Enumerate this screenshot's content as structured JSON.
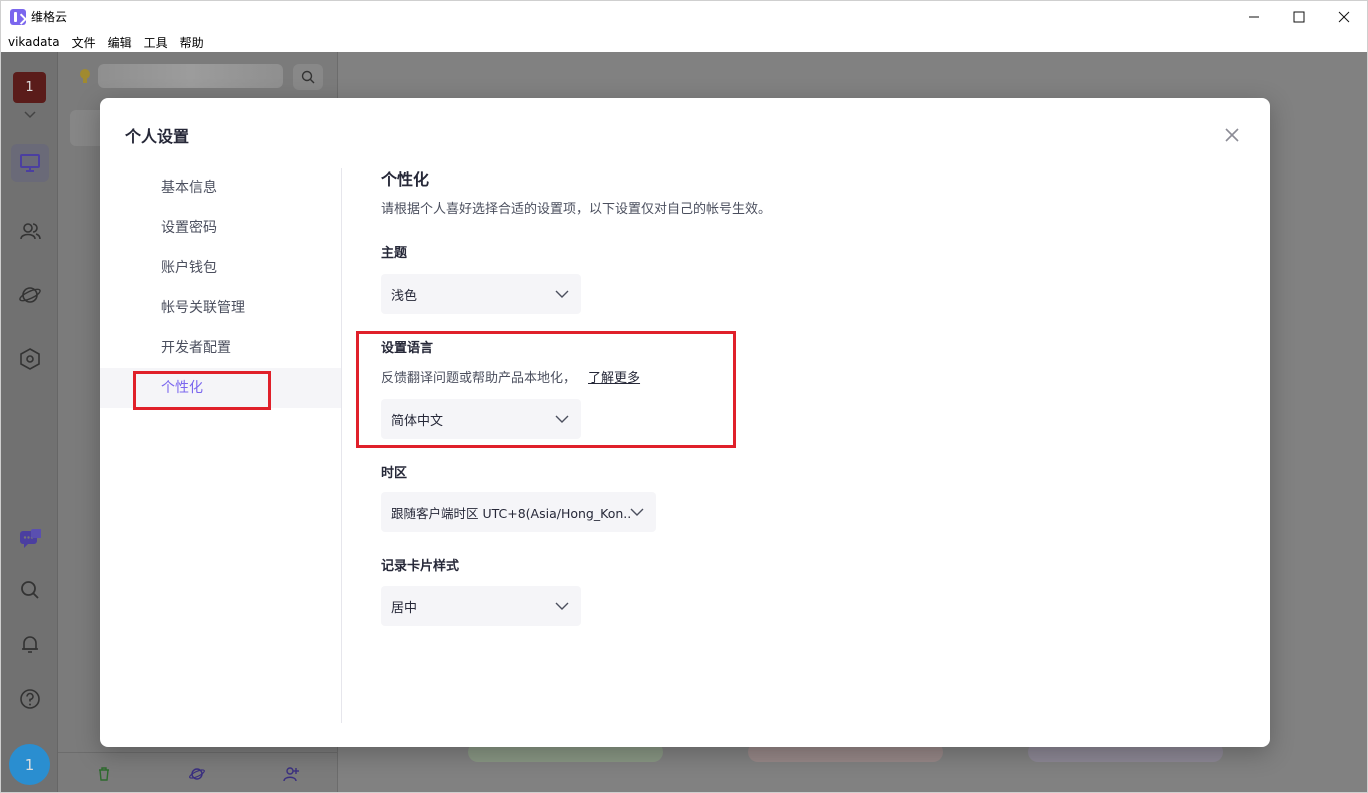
{
  "window": {
    "title": "维格云",
    "minimize": "—",
    "maximize": "☐",
    "close": "✕"
  },
  "menubar": [
    "vikadata",
    "文件",
    "编辑",
    "工具",
    "帮助"
  ],
  "rail": {
    "avatar": "1",
    "user_avatar": "1"
  },
  "colors": {
    "accent": "#7b67ee",
    "highlight": "#e0202a",
    "avatar_top": "#5a1c1a",
    "avatar_bottom": "#2a8ed0"
  },
  "modal": {
    "title": "个人设置",
    "nav": [
      "基本信息",
      "设置密码",
      "账户钱包",
      "帐号关联管理",
      "开发者配置",
      "个性化"
    ],
    "active_nav": "个性化",
    "heading": "个性化",
    "description": "请根据个人喜好选择合适的设置项，以下设置仅对自己的帐号生效。",
    "theme": {
      "label": "主题",
      "value": "浅色"
    },
    "language": {
      "label": "设置语言",
      "hint": "反馈翻译问题或帮助产品本地化，",
      "link": "了解更多",
      "value": "简体中文"
    },
    "timezone": {
      "label": "时区",
      "value": "跟随客户端时区 UTC+8(Asia/Hong_Kon..."
    },
    "card_style": {
      "label": "记录卡片样式",
      "value": "居中"
    }
  }
}
